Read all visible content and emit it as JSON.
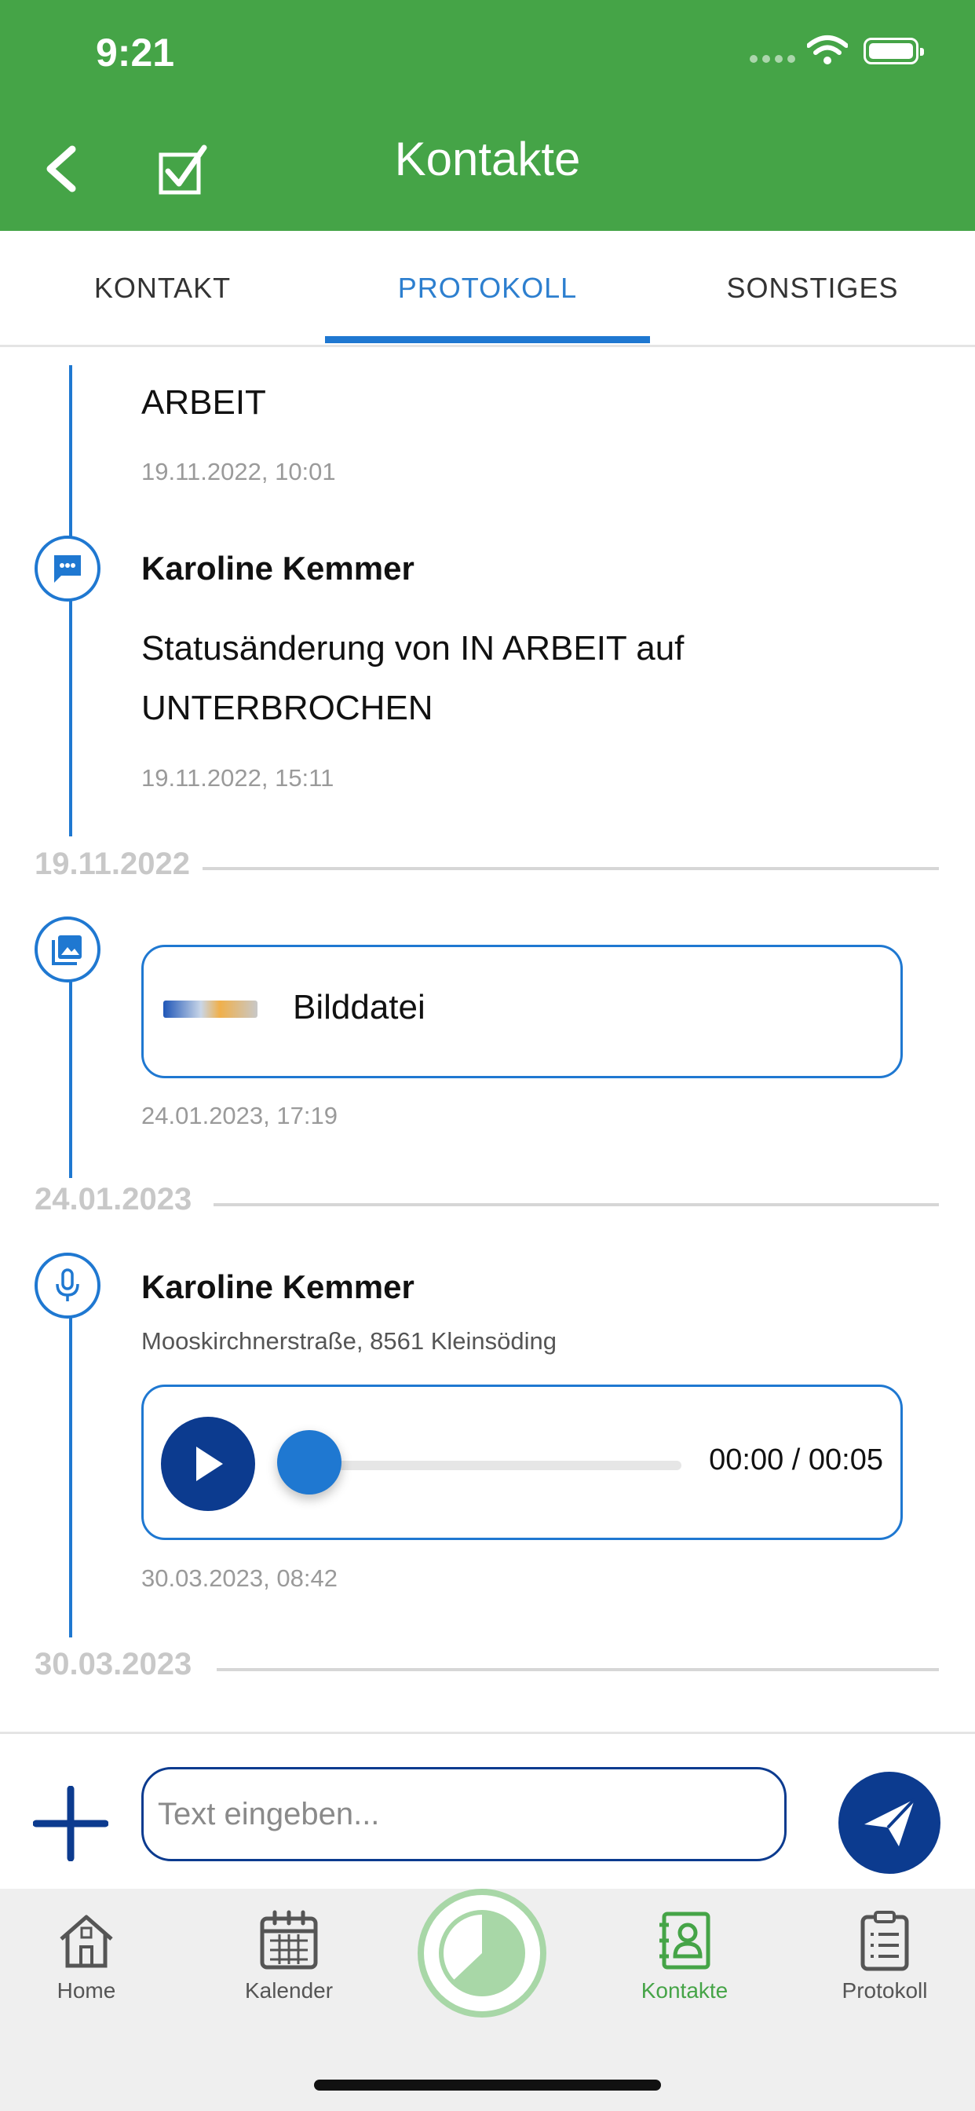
{
  "status_bar": {
    "time": "9:21"
  },
  "header": {
    "title": "Kontakte"
  },
  "tabs": [
    {
      "label": "KONTAKT",
      "active": false
    },
    {
      "label": "PROTOKOLL",
      "active": true
    },
    {
      "label": "SONSTIGES",
      "active": false
    }
  ],
  "timeline": {
    "entry1": {
      "text": "ARBEIT",
      "time": "19.11.2022, 10:01"
    },
    "entry2": {
      "author": "Karoline Kemmer",
      "text_line1": "Statusänderung von IN ARBEIT auf",
      "text_line2": "UNTERBROCHEN",
      "time": "19.11.2022, 15:11",
      "icon": "chat-icon"
    },
    "separator1": "19.11.2022",
    "entry3": {
      "file_label": "Bilddatei",
      "time": "24.01.2023, 17:19",
      "icon": "image-icon"
    },
    "separator2": "24.01.2023",
    "entry4": {
      "author": "Karoline Kemmer",
      "address": "Mooskirchnerstraße, 8561 Kleinsöding",
      "audio_time": "00:00 / 00:05",
      "audio_progress": 0,
      "time": "30.03.2023, 08:42",
      "icon": "microphone-icon"
    },
    "separator3": "30.03.2023"
  },
  "composer": {
    "placeholder": "Text eingeben..."
  },
  "bottom_nav": [
    {
      "label": "Home",
      "icon": "home-icon",
      "active": false
    },
    {
      "label": "Kalender",
      "icon": "calendar-icon",
      "active": false
    },
    {
      "label": "Kontakte",
      "icon": "contacts-icon",
      "active": true
    },
    {
      "label": "Protokoll",
      "icon": "clipboard-icon",
      "active": false
    }
  ],
  "colors": {
    "header_green": "#45a447",
    "accent_blue": "#1f78d1",
    "dark_blue": "#0c3b8f"
  }
}
